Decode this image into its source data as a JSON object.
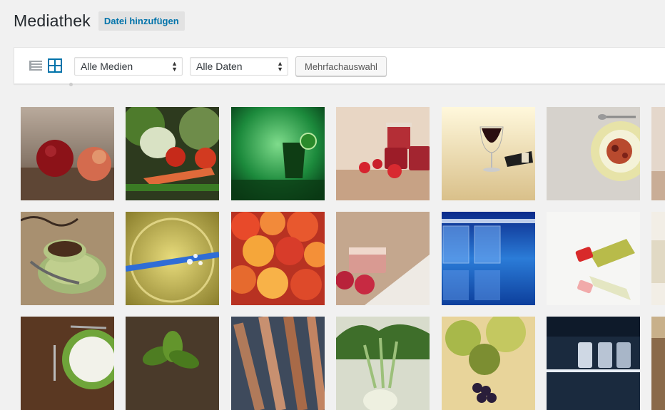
{
  "page": {
    "title": "Mediathek",
    "add_button": "Datei hinzufügen"
  },
  "toolbar": {
    "filter_type": {
      "selected": "Alle Medien"
    },
    "filter_date": {
      "selected": "Alle Daten"
    },
    "bulk_select": "Mehrfachauswahl",
    "icons": {
      "list_view": "list-view-icon",
      "grid_view": "grid-view-icon"
    },
    "active_view": "grid"
  },
  "colors": {
    "accent": "#0073aa",
    "background": "#f1f1f1"
  },
  "media": [
    {
      "id": "apples"
    },
    {
      "id": "vegetables"
    },
    {
      "id": "green-drink"
    },
    {
      "id": "strawberry-jam"
    },
    {
      "id": "red-wine"
    },
    {
      "id": "dish-spoon"
    },
    {
      "id": "cut-1"
    },
    {
      "id": "coffee-cup"
    },
    {
      "id": "glass-bubbles"
    },
    {
      "id": "plums"
    },
    {
      "id": "cake-berries"
    },
    {
      "id": "blue-glasses"
    },
    {
      "id": "wine-bottle"
    },
    {
      "id": "cut-2"
    },
    {
      "id": "plate-fork"
    },
    {
      "id": "basil"
    },
    {
      "id": "sausages"
    },
    {
      "id": "kohlrabi"
    },
    {
      "id": "grapes-vine"
    },
    {
      "id": "jars-shelf"
    },
    {
      "id": "cut-3"
    }
  ]
}
